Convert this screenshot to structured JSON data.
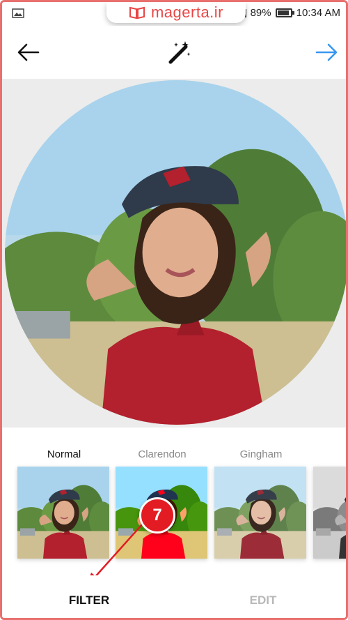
{
  "status_bar": {
    "battery_percent": "89%",
    "battery_level": 0.89,
    "time": "10:34 AM",
    "icons": [
      "gallery-icon",
      "signal-icon",
      "battery-icon"
    ]
  },
  "watermark": {
    "text": "magerta.ir",
    "color": "#e84545"
  },
  "toolbar": {
    "back_icon": "arrow-left-icon",
    "magic_icon": "magic-wand-icon",
    "next_icon": "arrow-right-icon",
    "next_color": "#3897f0"
  },
  "filters": [
    {
      "label": "Normal",
      "selected": true
    },
    {
      "label": "Clarendon",
      "selected": false
    },
    {
      "label": "Gingham",
      "selected": false
    },
    {
      "label": "",
      "selected": false
    }
  ],
  "step_marker": {
    "number": "7",
    "color": "#e31b23"
  },
  "tabs": {
    "filter_label": "FILTER",
    "edit_label": "EDIT",
    "active": "FILTER"
  },
  "colors": {
    "frame_border": "#e8716f",
    "preview_background": "#ececec"
  }
}
